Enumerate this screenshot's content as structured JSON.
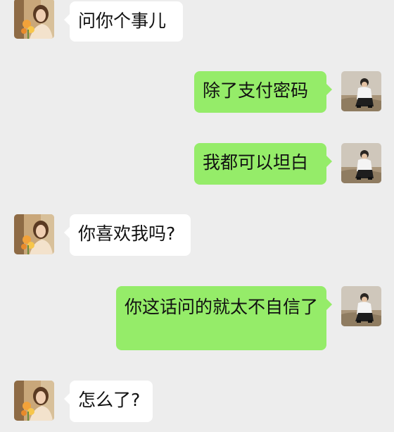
{
  "messages": [
    {
      "sender": "other",
      "text": "问你个事儿",
      "avatar": "woman-with-flowers-avatar"
    },
    {
      "sender": "self",
      "text": "除了支付密码",
      "avatar": "man-sitting-on-beach-avatar"
    },
    {
      "sender": "self",
      "text": "我都可以坦白",
      "avatar": "man-sitting-on-beach-avatar"
    },
    {
      "sender": "other",
      "text": "你喜欢我吗?",
      "avatar": "woman-with-flowers-avatar"
    },
    {
      "sender": "self",
      "text": "你这话问的就太不自信了",
      "avatar": "man-sitting-on-beach-avatar"
    },
    {
      "sender": "other",
      "text": "怎么了?",
      "avatar": "woman-with-flowers-avatar"
    }
  ],
  "colors": {
    "background": "#ededed",
    "incoming_bubble": "#ffffff",
    "outgoing_bubble": "#95ec69",
    "text": "#111111"
  }
}
